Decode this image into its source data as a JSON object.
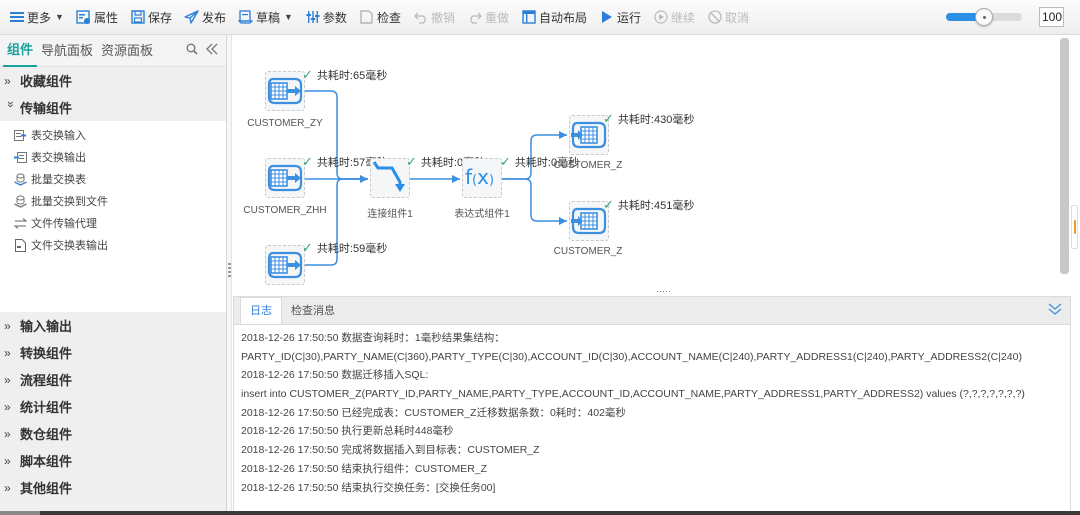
{
  "toolbar": {
    "buttons": [
      {
        "label": "更多",
        "icon": "menu-icon",
        "caret": true,
        "enabled": true
      },
      {
        "label": "属性",
        "icon": "properties-icon",
        "enabled": true
      },
      {
        "label": "保存",
        "icon": "save-icon",
        "enabled": true
      },
      {
        "label": "发布",
        "icon": "publish-icon",
        "enabled": true
      },
      {
        "label": "草稿",
        "icon": "draft-icon",
        "caret": true,
        "enabled": true
      },
      {
        "label": "参数",
        "icon": "parameters-icon",
        "enabled": true
      },
      {
        "label": "检查",
        "icon": "check-icon",
        "enabled": true
      },
      {
        "label": "撤销",
        "icon": "undo-icon",
        "enabled": false
      },
      {
        "label": "重做",
        "icon": "redo-icon",
        "enabled": false
      },
      {
        "label": "自动布局",
        "icon": "auto-layout-icon",
        "enabled": true
      },
      {
        "label": "运行",
        "icon": "play-icon",
        "enabled": true
      },
      {
        "label": "继续",
        "icon": "resume-icon",
        "enabled": false
      },
      {
        "label": "取消",
        "icon": "cancel-icon",
        "enabled": false
      }
    ],
    "zoom": {
      "value": "100",
      "slider_fraction": 0.5,
      "accent": "#2b8fe8"
    }
  },
  "left_panel": {
    "tabs": [
      {
        "label": "组件",
        "active": true
      },
      {
        "label": "导航面板",
        "active": false
      },
      {
        "label": "资源面板",
        "active": false
      }
    ],
    "accent": "#1aa39e",
    "groups_top": [
      {
        "label": "收藏组件",
        "expanded": false
      },
      {
        "label": "传输组件",
        "expanded": true
      }
    ],
    "transfer_items": [
      {
        "label": "表交换输入",
        "icon": "table-input-icon"
      },
      {
        "label": "表交换输出",
        "icon": "table-output-icon"
      },
      {
        "label": "批量交换表",
        "icon": "batch-exchange-icon"
      },
      {
        "label": "批量交换到文件",
        "icon": "batch-file-icon"
      },
      {
        "label": "文件传输代理",
        "icon": "transfer-arrows-icon"
      },
      {
        "label": "文件交换表输出",
        "icon": "file-output-icon"
      }
    ],
    "groups_bottom": [
      {
        "label": "输入输出"
      },
      {
        "label": "转换组件"
      },
      {
        "label": "流程组件"
      },
      {
        "label": "统计组件"
      },
      {
        "label": "数仓组件"
      },
      {
        "label": "脚本组件"
      },
      {
        "label": "其他组件"
      }
    ]
  },
  "canvas": {
    "nodes": [
      {
        "id": "n1",
        "label": "CUSTOMER_ZY",
        "type": "table-input",
        "timing": "共耗时:65毫秒"
      },
      {
        "id": "n2",
        "label": "CUSTOMER_ZHH",
        "type": "table-input",
        "timing": "共耗时:57毫秒"
      },
      {
        "id": "n3",
        "label": "",
        "type": "table-input",
        "timing": "共耗时:59毫秒"
      },
      {
        "id": "n4",
        "label": "连接组件1",
        "type": "join",
        "timing": "共耗时:0毫秒"
      },
      {
        "id": "n5",
        "label": "表达式组件1",
        "type": "expression",
        "timing": "共耗时:0毫秒"
      },
      {
        "id": "n6",
        "label": "CUSTOMER_Z",
        "type": "table-output",
        "timing": "共耗时:430毫秒"
      },
      {
        "id": "n7",
        "label": "CUSTOMER_Z",
        "type": "table-output",
        "timing": "共耗时:451毫秒"
      }
    ],
    "status_color": "#35a66b",
    "edge_color": "#3d8fe0"
  },
  "log_panel": {
    "tabs": [
      {
        "label": "日志",
        "active": true
      },
      {
        "label": "检查消息",
        "active": false
      }
    ],
    "lines": [
      "2018-12-26 17:50:50 数据查询耗时：1毫秒结果集结构：",
      "PARTY_ID(C|30),PARTY_NAME(C|360),PARTY_TYPE(C|30),ACCOUNT_ID(C|30),ACCOUNT_NAME(C|240),PARTY_ADDRESS1(C|240),PARTY_ADDRESS2(C|240)",
      "2018-12-26 17:50:50 数据迁移插入SQL:",
      "insert into CUSTOMER_Z(PARTY_ID,PARTY_NAME,PARTY_TYPE,ACCOUNT_ID,ACCOUNT_NAME,PARTY_ADDRESS1,PARTY_ADDRESS2) values (?,?,?,?,?,?,?)",
      "2018-12-26 17:50:50 已经完成表：CUSTOMER_Z迁移数据条数：0耗时：402毫秒",
      "2018-12-26 17:50:50 执行更新总耗时448毫秒",
      "2018-12-26 17:50:50 完成将数据插入到目标表：CUSTOMER_Z",
      "2018-12-26 17:50:50 结束执行组件：CUSTOMER_Z",
      "2018-12-26 17:50:50 结束执行交换任务：[交换任务00]"
    ]
  }
}
